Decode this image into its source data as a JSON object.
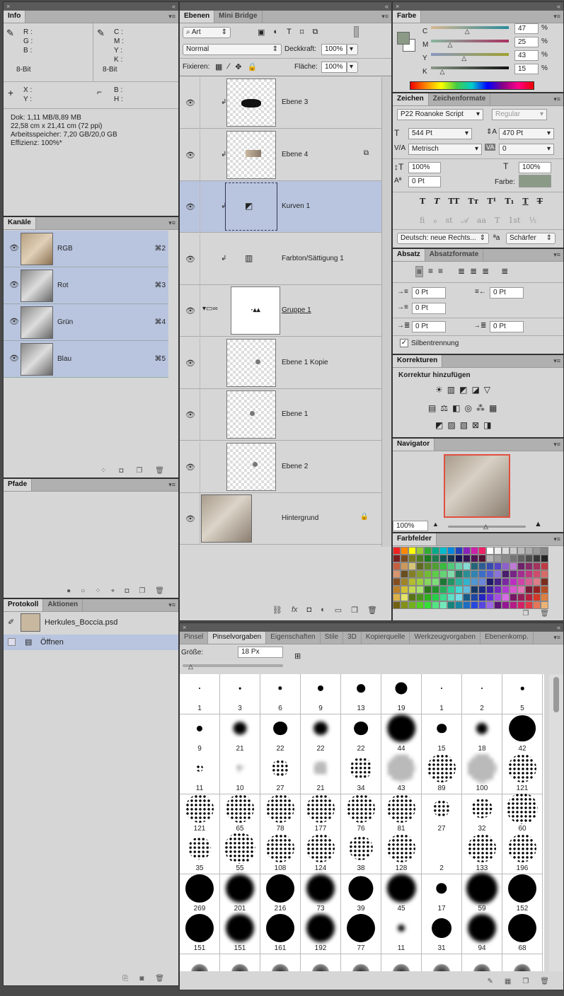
{
  "info": {
    "tab": "Info",
    "rgb": [
      "R :",
      "G :",
      "B :"
    ],
    "cmyk": [
      "C :",
      "M :",
      "Y :",
      "K :"
    ],
    "bit1": "8-Bit",
    "bit2": "8-Bit",
    "xy": [
      "X :",
      "Y :"
    ],
    "bh": [
      "B :",
      "H :"
    ],
    "doc": "Dok: 1,11 MB/8,89 MB",
    "size": "22,58 cm x 21,41 cm (72 ppi)",
    "mem": "Arbeitsspeicher: 7,20 GB/20,0 GB",
    "eff": "Effizienz: 100%*"
  },
  "channels": {
    "tab": "Kanäle",
    "items": [
      {
        "name": "RGB",
        "key": "⌘2"
      },
      {
        "name": "Rot",
        "key": "⌘3"
      },
      {
        "name": "Grün",
        "key": "⌘4"
      },
      {
        "name": "Blau",
        "key": "⌘5"
      }
    ]
  },
  "paths": {
    "tab": "Pfade"
  },
  "history": {
    "tabs": [
      "Protokoll",
      "Aktionen"
    ],
    "file": "Herkules_Boccia.psd",
    "step": "Öffnen"
  },
  "layers": {
    "tabs": [
      "Ebenen",
      "Mini Bridge"
    ],
    "filter": "Art",
    "blend": "Normal",
    "opacity_label": "Deckkraft:",
    "opacity": "100%",
    "lock_label": "Fixieren:",
    "fill_label": "Fläche:",
    "fill": "100%",
    "items": [
      {
        "name": "Ebene 3"
      },
      {
        "name": "Ebene 4"
      },
      {
        "name": "Kurven 1"
      },
      {
        "name": "Farbton/Sättigung 1"
      },
      {
        "name": "Gruppe 1"
      },
      {
        "name": "Ebene 1 Kopie"
      },
      {
        "name": "Ebene 1"
      },
      {
        "name": "Ebene 2"
      },
      {
        "name": "Hintergrund"
      }
    ]
  },
  "color": {
    "tab": "Farbe",
    "labels": [
      "C",
      "M",
      "Y",
      "K"
    ],
    "values": [
      "47",
      "25",
      "43",
      "15"
    ],
    "pct": "%",
    "swatch": "#8a9a86"
  },
  "character": {
    "tabs": [
      "Zeichen",
      "Zeichenformate"
    ],
    "font": "P22 Roanoke Script",
    "style": "Regular",
    "size": "544 Pt",
    "leading": "470 Pt",
    "kerning": "Metrisch",
    "tracking": "0",
    "vscale": "100%",
    "hscale": "100%",
    "baseline": "0 Pt",
    "color_label": "Farbe:",
    "lang": "Deutsch: neue Rechts...",
    "aa": "Schärfer"
  },
  "paragraph": {
    "tabs": [
      "Absatz",
      "Absatzformate"
    ],
    "indent_left": "0 Pt",
    "indent_right": "0 Pt",
    "first_line": "0 Pt",
    "space_before": "0 Pt",
    "space_after": "0 Pt",
    "hyphen": "Silbentrennung"
  },
  "adjustments": {
    "tab": "Korrekturen",
    "title": "Korrektur hinzufügen"
  },
  "navigator": {
    "tab": "Navigator",
    "zoom": "100%"
  },
  "swatches": {
    "tab": "Farbfelder"
  },
  "brushes": {
    "tabs": [
      "Pinsel",
      "Pinselvorgaben",
      "Eigenschaften",
      "Stile",
      "3D",
      "Kopierquelle",
      "Werkzeugvorgaben",
      "Ebenenkomp."
    ],
    "size_label": "Größe:",
    "size": "18 Px",
    "sizes": [
      1,
      3,
      6,
      9,
      13,
      19,
      1,
      2,
      5,
      9,
      21,
      22,
      22,
      22,
      44,
      15,
      18,
      42,
      11,
      10,
      27,
      21,
      34,
      43,
      89,
      100,
      121,
      121,
      65,
      78,
      177,
      76,
      81,
      27,
      32,
      60,
      35,
      55,
      108,
      124,
      38,
      128,
      2,
      133,
      196,
      269,
      201,
      216,
      73,
      39,
      45,
      17,
      59,
      152,
      151,
      151,
      161,
      192,
      77,
      11,
      31,
      94,
      68
    ]
  }
}
